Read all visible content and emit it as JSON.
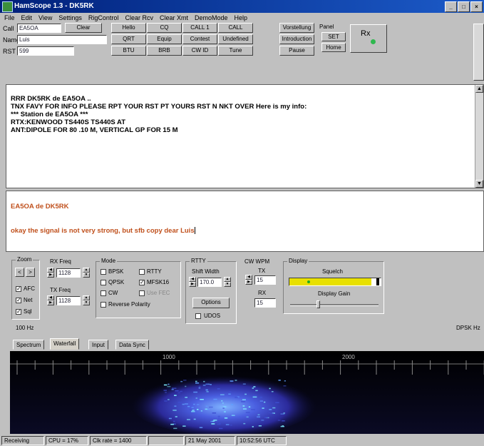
{
  "window": {
    "title": "HamScope 1.3 - DK5RK",
    "buttons": [
      "_",
      "□",
      "×"
    ]
  },
  "menu": [
    "File",
    "Edit",
    "View",
    "Settings",
    "RigControl",
    "Clear Rcv",
    "Clear Xmt",
    "DemoMode",
    "Help"
  ],
  "station": {
    "call_label": "Call",
    "call_value": "EA5OA",
    "clear_label": "Clear",
    "name_label": "Name",
    "name_value": "Luis",
    "rst_label": "RST",
    "rst_value": "599"
  },
  "macros": {
    "row1": [
      "Hello",
      "CQ",
      "CALL 1",
      "CALL",
      "Vorstellung"
    ],
    "row2": [
      "QRT",
      "Equip",
      "Contest",
      "Undefined",
      "Introduction"
    ],
    "row3": [
      "BTU",
      "BRB",
      "CW ID",
      "Tune",
      "Pause"
    ]
  },
  "panel": {
    "panel_label": "Panel",
    "set_label": "SET",
    "home_label": "Home",
    "rx_label": "Rx",
    "rx_color": "#2fb84f"
  },
  "receive": {
    "lines": [
      "RRR DK5RK de EA5OA ..",
      "TNX FAVY FOR INFO PLEASE RPT YOUR RST PT YOURS RST N NKT OVER Here is my info:",
      "*** Station de EA5OA ***",
      "RTX:KENWOOD TS440S TS440S AT",
      "ANT:DIPOLE FOR 80 .10 M, VERTICAL GP FOR 15 M"
    ]
  },
  "transmit": {
    "line1": "EA5OA de DK5RK",
    "line2": "okay the signal is not very strong, but sfb copy dear Luis",
    "text_color": "#c0501c"
  },
  "controls": {
    "zoom_label": "Zoom",
    "zoom_btns": [
      "<",
      ">"
    ],
    "afc_label": "AFC",
    "net_label": "Net",
    "sql_label": "Sql",
    "rxfreq_label": "RX Freq",
    "rxfreq_value": "1128",
    "txfreq_label": "TX Freq",
    "txfreq_value": "1128",
    "mode_label": "Mode",
    "modes": {
      "bpsk": "BPSK",
      "rtty": "RTTY",
      "qpsk": "QPSK",
      "mfsk": "MFSK16",
      "cw": "CW",
      "usefec": "Use FEC",
      "reverse": "Reverse Polarity"
    },
    "rtty_label": "RTTY",
    "shift_label": "Shift Width",
    "shift_value": "170.0",
    "options_label": "Options",
    "udos_label": "UDOS",
    "cwwpm_label": "CW WPM",
    "tx_label": "TX",
    "tx_value": "15",
    "rx_label": "RX",
    "rx_value": "15",
    "display_label": "Display",
    "squelch_label": "Squelch",
    "squelch_color": "#e8e000",
    "squelch_level": 0.9,
    "gain_label": "Display Gain",
    "gain_level": 0.3,
    "hz_label": "100 Hz",
    "right_label": "DPSK Hz"
  },
  "tabs": [
    "Spectrum",
    "Waterfall",
    "Input",
    "Data Sync"
  ],
  "waterfall": {
    "tick_labels": [
      "1000",
      "2000"
    ]
  },
  "status": [
    "Receiving",
    "CPU = 17%",
    "Clk rate = 1400",
    "",
    "21 May 2001",
    "10:52:56 UTC"
  ]
}
